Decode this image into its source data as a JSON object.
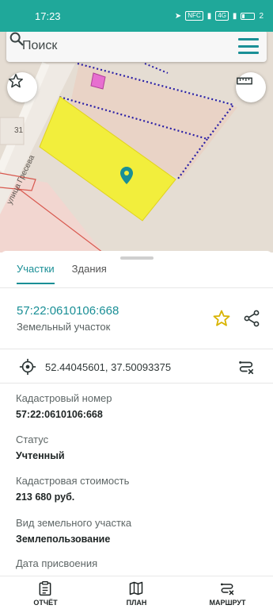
{
  "status_bar": {
    "time": "17:23",
    "signal_badge_1": "NFC",
    "signal_badge_2": "4G",
    "battery": "2"
  },
  "search": {
    "placeholder": "Поиск"
  },
  "map": {
    "street_label": "улица Гресева",
    "house_number": "31"
  },
  "tabs": [
    {
      "label": "Участки",
      "active": true
    },
    {
      "label": "Здания",
      "active": false
    }
  ],
  "parcel": {
    "number": "57:22:0610106:668",
    "type": "Земельный участок"
  },
  "coordinates": "52.44045601, 37.50093375",
  "fields": [
    {
      "label": "Кадастровый номер",
      "value": "57:22:0610106:668"
    },
    {
      "label": "Статус",
      "value": "Учтенный"
    },
    {
      "label": "Кадастровая стоимость",
      "value": "213 680 руб."
    },
    {
      "label": "Вид земельного участка",
      "value": "Землепользование"
    },
    {
      "label": "Дата присвоения",
      "value": ""
    }
  ],
  "bottom_nav": [
    {
      "label": "ОТЧЁТ",
      "icon": "report-icon"
    },
    {
      "label": "ПЛАН",
      "icon": "map-plan-icon"
    },
    {
      "label": "МАРШРУТ",
      "icon": "route-icon"
    }
  ],
  "colors": {
    "accent": "#1a8f96",
    "status_bar": "#1fa89a",
    "parcel_highlight": "#f2ee3c",
    "boundary_dotted": "#2a1fa6",
    "star": "#d8b300"
  }
}
